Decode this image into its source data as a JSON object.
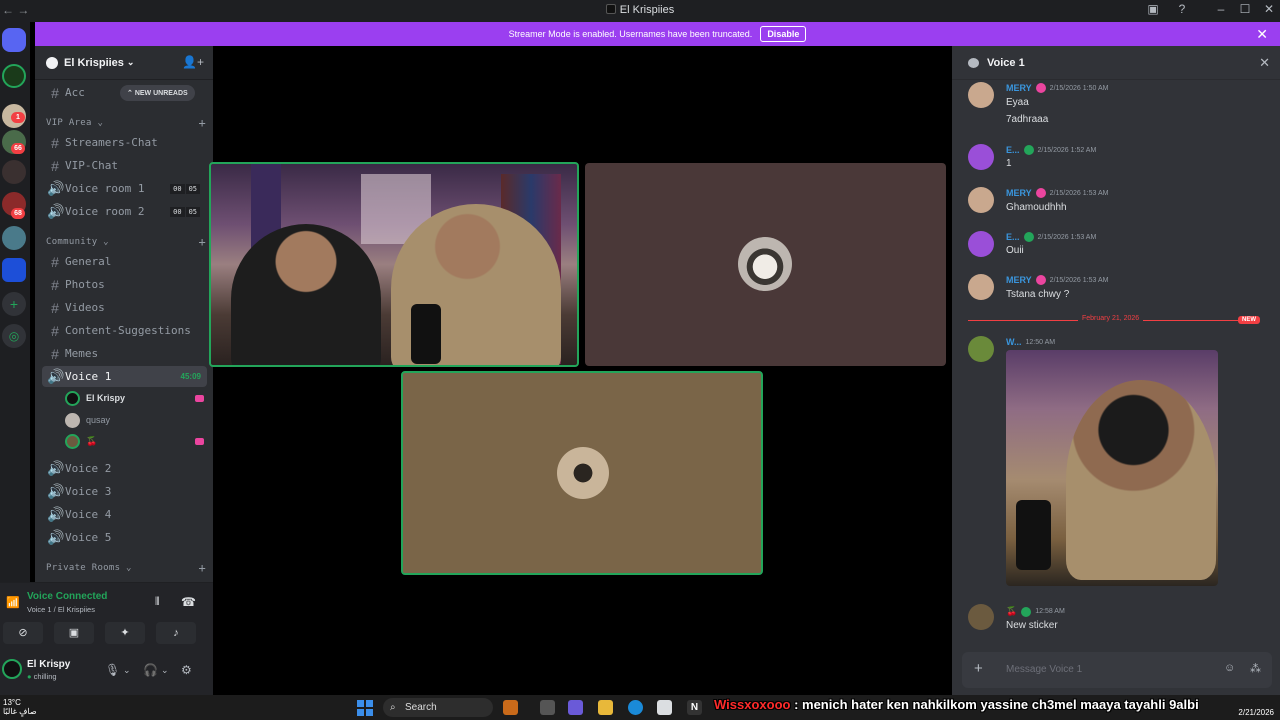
{
  "window": {
    "title": "El Krispiies"
  },
  "banner": {
    "text": "Streamer Mode is enabled. Usernames have been truncated.",
    "button": "Disable"
  },
  "server": {
    "name": "El Krispiies"
  },
  "sidebar": {
    "unread_channel": "Acc",
    "new_unreads": "NEW UNREADS",
    "categories": {
      "vip": "VIP Area",
      "community": "Community",
      "private": "Private Rooms"
    },
    "channels": [
      {
        "name": "Streamers-Chat",
        "type": "text"
      },
      {
        "name": "VIP-Chat",
        "type": "text"
      },
      {
        "name": "Voice room 1",
        "type": "voice",
        "a": "00",
        "b": "05"
      },
      {
        "name": "Voice room 2",
        "type": "voice",
        "a": "00",
        "b": "05"
      },
      {
        "name": "General",
        "type": "text"
      },
      {
        "name": "Photos",
        "type": "text"
      },
      {
        "name": "Videos",
        "type": "text"
      },
      {
        "name": "Content-Suggestions",
        "type": "text"
      },
      {
        "name": "Memes",
        "type": "text"
      },
      {
        "name": "Voice 1",
        "type": "voice",
        "timer": "45:09"
      },
      {
        "name": "Voice 2",
        "type": "voice"
      },
      {
        "name": "Voice 3",
        "type": "voice"
      },
      {
        "name": "Voice 4",
        "type": "voice"
      },
      {
        "name": "Voice 5",
        "type": "voice"
      }
    ],
    "voice_users": [
      {
        "name": "El Krispy"
      },
      {
        "name": "qusay"
      },
      {
        "name": "🍒"
      }
    ]
  },
  "voice_panel": {
    "status": "Voice Connected",
    "location": "Voice 1 / El Krispiies"
  },
  "user_panel": {
    "name": "El Krispy",
    "status": "chilling"
  },
  "chat": {
    "title": "Voice 1",
    "messages": [
      {
        "author": "MERY",
        "time": "2/15/2026 1:50 AM",
        "lines": [
          "Eyaa",
          "7adhraaa"
        ]
      },
      {
        "author": "E...",
        "time": "2/15/2026 1:52 AM",
        "lines": [
          "1"
        ]
      },
      {
        "author": "MERY",
        "time": "2/15/2026 1:53 AM",
        "lines": [
          "Ghamoudhhh"
        ]
      },
      {
        "author": "E...",
        "time": "2/15/2026 1:53 AM",
        "lines": [
          "Ouii"
        ]
      },
      {
        "author": "MERY",
        "time": "2/15/2026 1:53 AM",
        "lines": [
          "Tstana chwy ?"
        ]
      },
      {
        "author": "W...",
        "time": "12:50 AM",
        "lines": []
      },
      {
        "author": "🍒",
        "time": "12:58 AM",
        "lines": [
          "New sticker"
        ]
      }
    ],
    "divider_date": "February 21, 2026",
    "new_tag": "NEW",
    "input_placeholder": "Message Voice 1"
  },
  "taskbar": {
    "temp": "13°C",
    "weather": "صافٍ غالبًا",
    "search": "Search",
    "overlay_user": "Wissxoxooo",
    "overlay_text": ": menich hater ken nahkilkom yassine ch3mel maaya tayahli 9albi",
    "date": "2/21/2026"
  },
  "colors": {
    "accent_purple": "#9b3ff0",
    "online_green": "#23a55a",
    "mention_red": "#f23f43",
    "mery_name": "#3a96dd",
    "e_name": "#3a96dd"
  }
}
